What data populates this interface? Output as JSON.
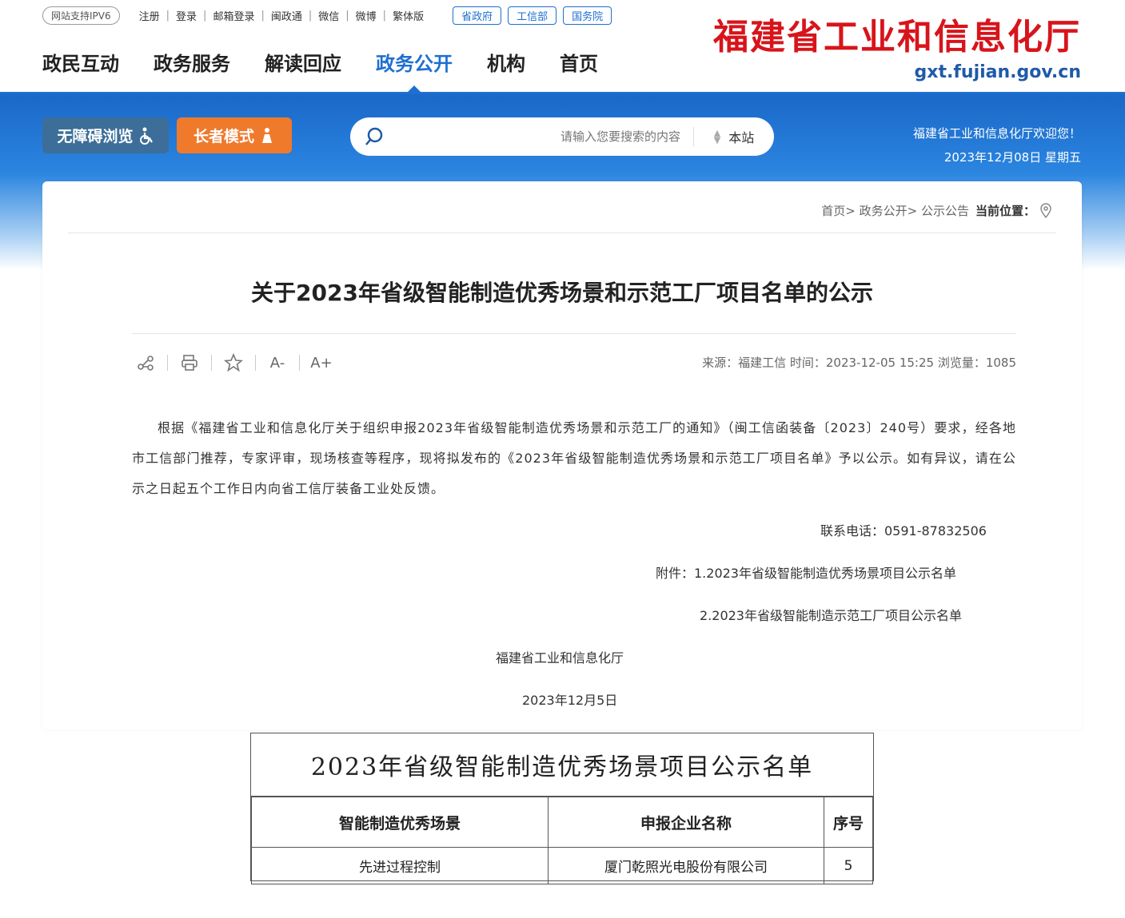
{
  "header": {
    "ipv6_label": "网站支持IPV6",
    "util_links": [
      "注册",
      "登录",
      "邮箱登录",
      "闽政通",
      "微信",
      "微博",
      "繁体版"
    ],
    "gov_links": [
      "省政府",
      "工信部",
      "国务院"
    ],
    "site_name": "福建省工业和信息化厅",
    "site_url": "gxt.fujian.gov.cn",
    "nav": [
      "政民互动",
      "政务服务",
      "解读回应",
      "政务公开",
      "机构",
      "首页"
    ],
    "nav_active_index": 3
  },
  "banner": {
    "accessible_label": "无障碍浏览",
    "elder_label": "长者模式",
    "search_placeholder": "请输入您要搜索的内容",
    "search_scope": "本站",
    "welcome": "福建省工业和信息化厅欢迎您！",
    "date": "2023年12月08日 星期五"
  },
  "breadcrumb": {
    "location_label": "当前位置：",
    "path": "首页> 政务公开> 公示公告"
  },
  "article": {
    "title": "关于2023年省级智能制造优秀场景和示范工厂项目名单的公示",
    "meta": "来源：福建工信  时间：2023-12-05 15:25  浏览量：1085",
    "tools": [
      "A+",
      "A-",
      "☆",
      "打印",
      "分享"
    ],
    "para1": "根据《福建省工业和信息化厅关于组织申报2023年省级智能制造优秀场景和示范工厂的通知》（闽工信函装备〔2023〕240号）要求，经各地市工信部门推荐，专家评审，现场核查等程序，现将拟发布的《2023年省级智能制造优秀场景和示范工厂项目名单》予以公示。如有异议，请在公示之日起五个工作日内向省工信厅装备工业处反馈。",
    "contact": "联系电话：0591-87832506",
    "attach1": "附件：1.2023年省级智能制造优秀场景项目公示名单",
    "attach2": "2.2023年省级智能制造示范工厂项目公示名单",
    "signer": "福建省工业和信息化厅",
    "sign_date": "2023年12月5日"
  },
  "sheet": {
    "title": "2023年省级智能制造优秀场景项目公示名单",
    "headers": [
      "智能制造优秀场景",
      "申报企业名称",
      "序号"
    ],
    "row": [
      "先进过程控制",
      "厦门乾照光电股份有限公司",
      "5"
    ]
  }
}
